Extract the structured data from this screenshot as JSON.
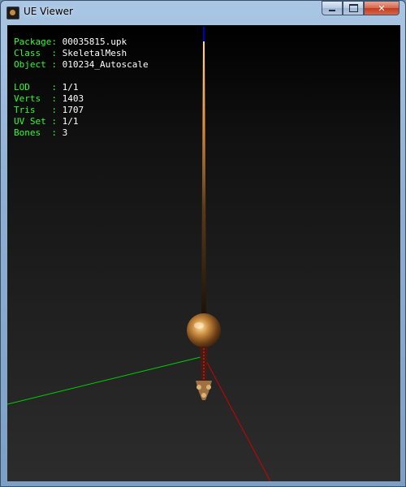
{
  "window": {
    "title": "UE Viewer"
  },
  "caption_buttons": {
    "minimize": "minimize",
    "maximize": "maximize",
    "close": "✕"
  },
  "info": {
    "rows": [
      {
        "key": "Package:",
        "value": "00035815.upk"
      },
      {
        "key": "Class  :",
        "value": "SkeletalMesh"
      },
      {
        "key": "Object :",
        "value": "010234_Autoscale"
      }
    ],
    "stats": [
      {
        "key": "LOD    :",
        "value": "1/1"
      },
      {
        "key": "Verts  :",
        "value": "1403"
      },
      {
        "key": "Tris   :",
        "value": "1707"
      },
      {
        "key": "UV Set :",
        "value": "1/1"
      },
      {
        "key": "Bones  :",
        "value": "3"
      }
    ]
  },
  "colors": {
    "text_key": "#2cff2c",
    "axis_x": "#d00000",
    "axis_y": "#00d000",
    "axis_z": "#0000ff",
    "mesh": "#c7893d"
  }
}
